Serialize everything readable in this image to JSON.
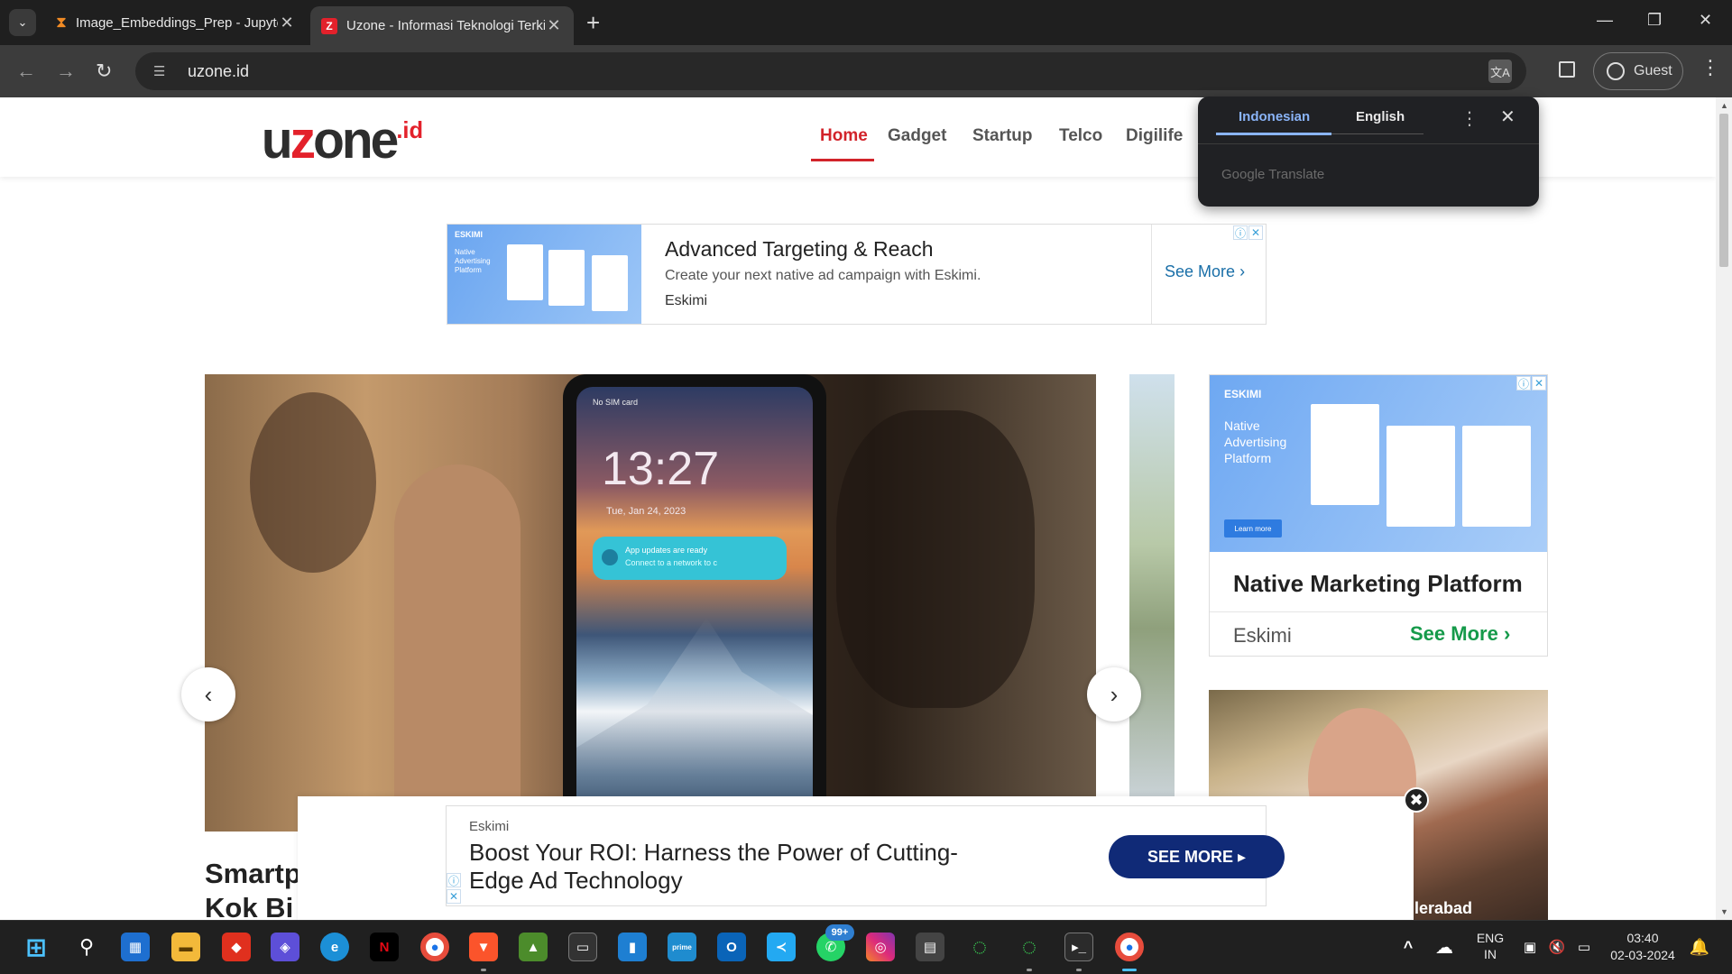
{
  "browser": {
    "tabs": [
      {
        "title": "Image_Embeddings_Prep - Jupyter",
        "close": "✕"
      },
      {
        "title": "Uzone - Informasi Teknologi Terkini",
        "close": "✕"
      }
    ],
    "new_tab": "+",
    "url": "uzone.id",
    "guest_label": "Guest",
    "window": {
      "minimize": "—",
      "restore": "❐",
      "close": "✕"
    }
  },
  "site": {
    "logo": {
      "u": "u",
      "z": "z",
      "rest": "one",
      "suffix": ".id"
    },
    "nav": [
      "Home",
      "Gadget",
      "Startup",
      "Telco",
      "Digilife"
    ]
  },
  "ad_top": {
    "brand": "ESKIMI",
    "thumb_text": "Native Advertising Platform",
    "title": "Advanced Targeting & Reach",
    "description": "Create your next native ad campaign with Eskimi.",
    "advertiser": "Eskimi",
    "cta": "See More"
  },
  "carousel": {
    "clock": "13:27",
    "date": "Tue, Jan 24, 2023",
    "sim": "No SIM card",
    "notif_title": "App updates are ready",
    "notif_text": "Connect to a network to c",
    "prev": "‹",
    "next": "›"
  },
  "article_headline": [
    "Smartp",
    "Kok Bi"
  ],
  "ad_side": {
    "brand": "ESKIMI",
    "image_text": "Native Advertising Platform",
    "learn_more": "Learn more",
    "title": "Native Marketing Platform",
    "advertiser": "Eskimi",
    "cta": "See More"
  },
  "photo_caption": "lerabad",
  "sticky_ad": {
    "advertiser": "Eskimi",
    "headline": "Boost Your ROI: Harness the Power of Cutting-Edge Ad Technology",
    "cta": "SEE MORE",
    "close": "✖"
  },
  "translate_popup": {
    "source": "Indonesian",
    "target": "English",
    "footer": "Google Translate"
  },
  "taskbar": {
    "badge": "99+",
    "lang_line1": "ENG",
    "lang_line2": "IN",
    "time": "03:40",
    "date": "02-03-2024"
  }
}
